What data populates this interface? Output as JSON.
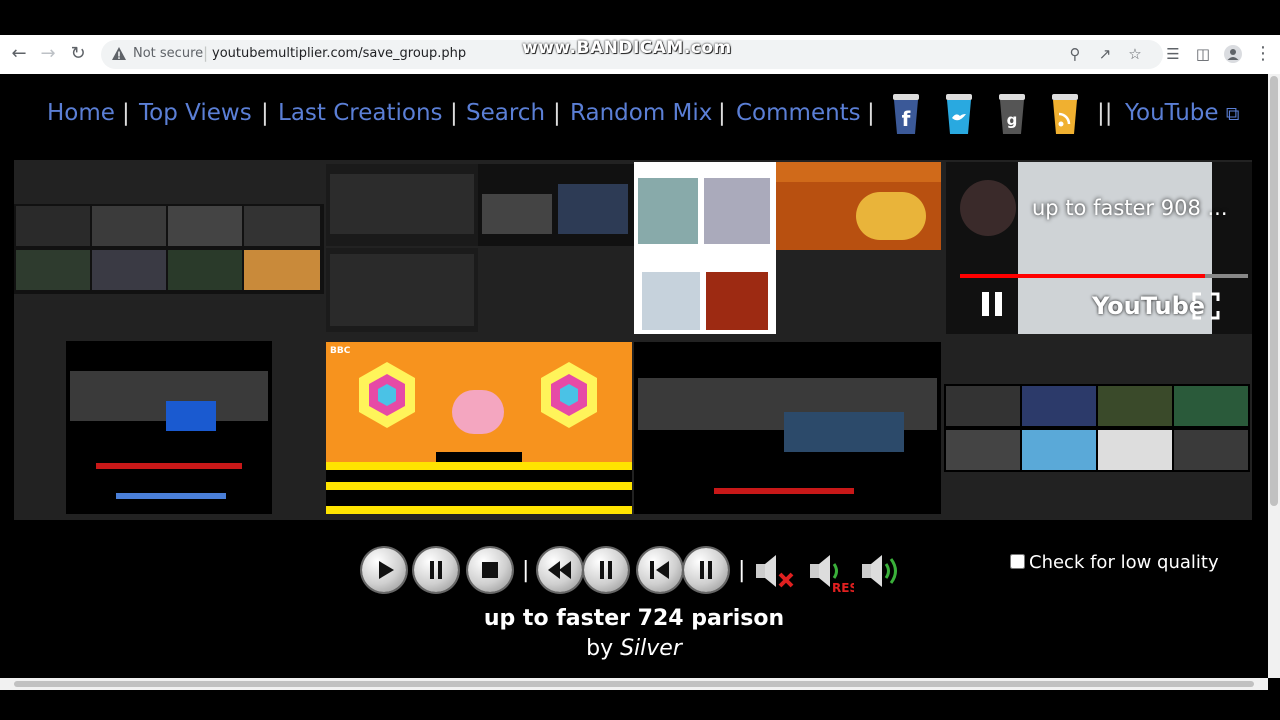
{
  "watermark": "www.BANDICAM.com",
  "browser": {
    "security_label": "Not secure",
    "url": "youtubemultiplier.com/save_group.php"
  },
  "nav": {
    "links": [
      "Home",
      "Top Views",
      "Last Creations",
      "Search",
      "Random Mix",
      "Comments"
    ],
    "youtube_label": "YouTube",
    "separator": "|",
    "double_separator": "||"
  },
  "social": [
    "facebook-icon",
    "twitter-icon",
    "google-plus-icon",
    "rss-icon"
  ],
  "player": {
    "overlay_title": "up to faster 908 ...",
    "brand": "YouTube",
    "bbc_logo": "BBC"
  },
  "controls": {
    "separator": "|",
    "low_quality_label": "Check for low quality",
    "low_quality_checked": false
  },
  "mashup": {
    "title": "up to faster 724 parison",
    "by_prefix": "by",
    "author": "Silver"
  },
  "colors": {
    "nav_link": "#5b7fd6",
    "orange_bg": "#f7931e",
    "progress_red": "#ff0000"
  }
}
